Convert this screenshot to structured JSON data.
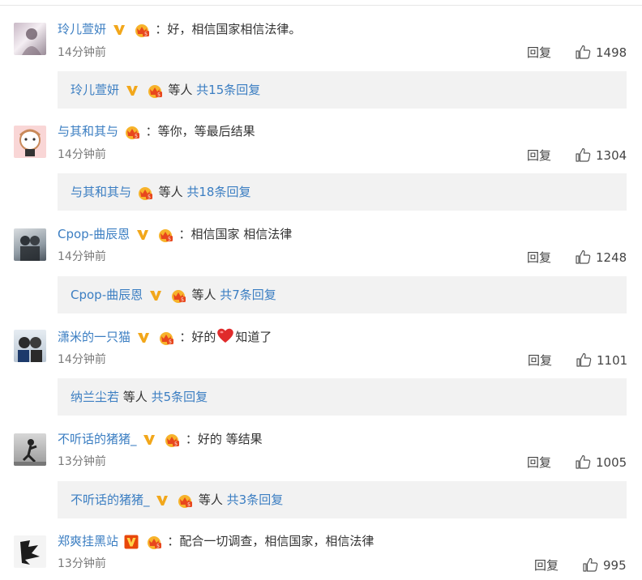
{
  "comments": [
    {
      "username": "玲儿萱妍",
      "verified": true,
      "verified_color": "#f2a71b",
      "separator": "：",
      "text": "好，相信国家相信法律。",
      "time": "14分钟前",
      "reply_label": "回复",
      "likes": "1498",
      "sub": {
        "user": "玲儿萱妍",
        "etc": "等人",
        "total": "共15条回复",
        "verified": true
      }
    },
    {
      "username": "与其和其与",
      "verified": false,
      "separator": "：",
      "text": "等你，等最后结果",
      "time": "14分钟前",
      "reply_label": "回复",
      "likes": "1304",
      "sub": {
        "user": "与其和其与",
        "etc": "等人",
        "total": "共18条回复",
        "verified": false
      }
    },
    {
      "username": "Cpop-曲辰恩",
      "verified": true,
      "verified_color": "#f2a71b",
      "separator": "：",
      "text": "相信国家 相信法律",
      "time": "14分钟前",
      "reply_label": "回复",
      "likes": "1248",
      "sub": {
        "user": "Cpop-曲辰恩",
        "etc": "等人",
        "total": "共7条回复",
        "verified": true
      }
    },
    {
      "username": "潇米的一只猫",
      "verified": true,
      "verified_color": "#f2a71b",
      "separator": "：",
      "text_before": "好的",
      "text_after": "知道了",
      "has_heart": true,
      "time": "14分钟前",
      "reply_label": "回复",
      "likes": "1101",
      "sub": {
        "user": "纳兰尘若",
        "etc": "等人",
        "total": "共5条回复",
        "verified": false,
        "no_crown": true
      }
    },
    {
      "username": "不听话的猪猪_",
      "verified": true,
      "verified_color": "#f2a71b",
      "separator": "：",
      "text": "好的 等结果",
      "time": "13分钟前",
      "reply_label": "回复",
      "likes": "1005",
      "sub": {
        "user": "不听话的猪猪_",
        "etc": "等人",
        "total": "共3条回复",
        "verified": true
      }
    },
    {
      "username": "郑爽挂黑站",
      "verified": true,
      "verified_color": "#e8470a",
      "verified_box": true,
      "separator": "：",
      "text": "配合一切调查，相信国家，相信法律",
      "time": "13分钟前",
      "reply_label": "回复",
      "likes": "995"
    }
  ],
  "colors": {
    "link": "#3b7ec2",
    "sub_background": "#f2f2f2",
    "time": "#7a7a7a"
  },
  "icons": [
    "verified-v-icon",
    "vip-crown-icon",
    "thumbs-up-icon",
    "heart-emoji-icon"
  ]
}
